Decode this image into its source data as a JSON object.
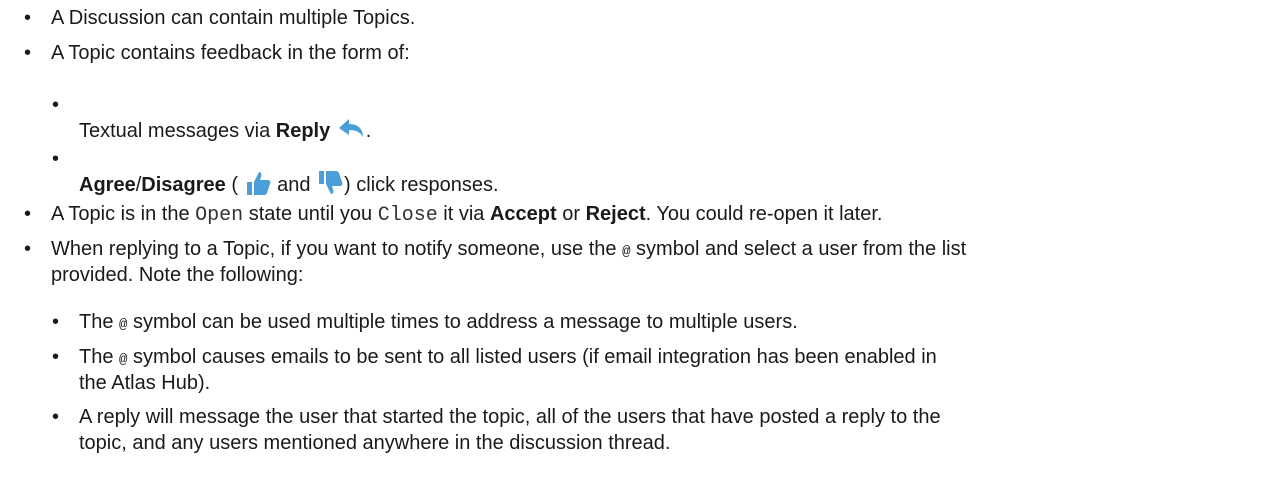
{
  "items": {
    "b1": {
      "text": "A Discussion can contain multiple Topics."
    },
    "b2": {
      "text": "A Topic contains feedback in the form of:"
    },
    "s1": {
      "pre": "Textual messages via ",
      "bold": "Reply",
      "post": "."
    },
    "s2": {
      "bold1": "Agree",
      "slash": "/",
      "bold2": "Disagree",
      "open": " (",
      "and": " and ",
      "post": ") click responses."
    },
    "b3": {
      "pre": "A Topic is in the ",
      "code1": "Open",
      "mid": " state until you ",
      "code2": "Close",
      "mid2": " it via ",
      "bold1": "Accept",
      "or": " or ",
      "bold2": "Reject",
      "post": ". You could re-open it later."
    },
    "b4": {
      "pre": "When replying to a Topic, if you want to notify someone, use the ",
      "at": "@",
      "post": " symbol and select a user from the list",
      "line2": "provided. Note the following:"
    },
    "n1": {
      "pre": "The ",
      "at": "@",
      "post": " symbol can be used multiple times to address a message to multiple users."
    },
    "n2": {
      "pre": "The ",
      "at": "@",
      "post": " symbol causes emails to be sent to all listed users (if email integration has been enabled in",
      "line2": "the Atlas Hub)."
    },
    "n3": {
      "line1": "A reply will message the user that started the topic, all of the users that have posted a reply to the",
      "line2": "topic, and any users mentioned anywhere in the discussion thread."
    }
  },
  "icons": {
    "reply": "reply-arrow-icon",
    "agree": "thumbs-up-icon",
    "disagree": "thumbs-down-icon",
    "accent": "#4a9fd8"
  }
}
